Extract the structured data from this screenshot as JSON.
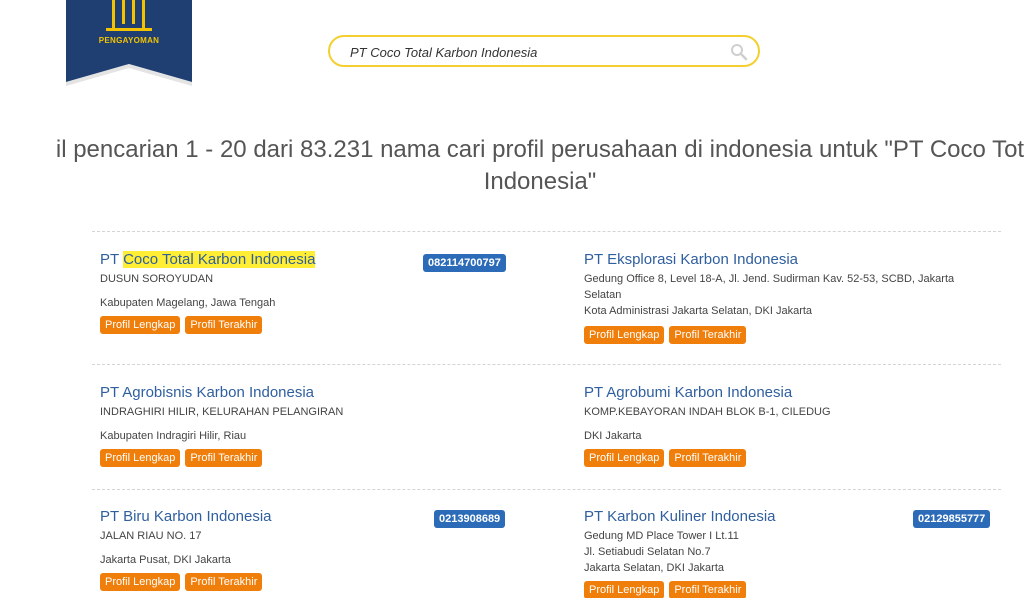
{
  "logo": {
    "text": "PENGAYOMAN"
  },
  "search": {
    "value": "PT Coco Total Karbon Indonesia"
  },
  "heading": {
    "line1": "il pencarian 1 - 20 dari 83.231 nama cari profil perusahaan di indonesia untuk \"PT Coco Tot",
    "line2": "Indonesia\""
  },
  "buttons": {
    "profile": "Profil Lengkap",
    "latest": "Profil Terakhir"
  },
  "results": [
    {
      "title_prefix": "PT ",
      "title_highlight": "Coco Total Karbon Indonesia",
      "address": "DUSUN SOROYUDAN",
      "city": "Kabupaten Magelang, Jawa Tengah",
      "phone": "082114700797"
    },
    {
      "title": "PT Eksplorasi Karbon Indonesia",
      "address": "Gedung Office 8, Level 18-A, Jl. Jend. Sudirman Kav. 52-53, SCBD, Jakarta Selatan",
      "city": "Kota Administrasi Jakarta Selatan, DKI Jakarta"
    },
    {
      "title": "PT Agrobisnis Karbon Indonesia",
      "address": "INDRAGHIRI HILIR, KELURAHAN PELANGIRAN",
      "city": "Kabupaten Indragiri Hilir, Riau"
    },
    {
      "title": "PT Agrobumi Karbon Indonesia",
      "address": "KOMP.KEBAYORAN INDAH BLOK B-1, CILEDUG",
      "city": "DKI Jakarta"
    },
    {
      "title": "PT Biru Karbon Indonesia",
      "address": "JALAN RIAU NO. 17",
      "city": "Jakarta Pusat, DKI Jakarta",
      "phone": "0213908689"
    },
    {
      "title": "PT Karbon Kuliner Indonesia",
      "address_line1": "Gedung MD Place Tower I Lt.11",
      "address_line2": "Jl. Setiabudi Selatan No.7",
      "city": "Jakarta Selatan, DKI Jakarta",
      "phone": "02129855777"
    }
  ],
  "colors": {
    "link": "#2f5f9e",
    "button": "#f07e0a",
    "phone": "#2b6bb8",
    "highlight": "#ffee33",
    "search_border": "#f3cf2f",
    "logo": "#1f3f73"
  }
}
